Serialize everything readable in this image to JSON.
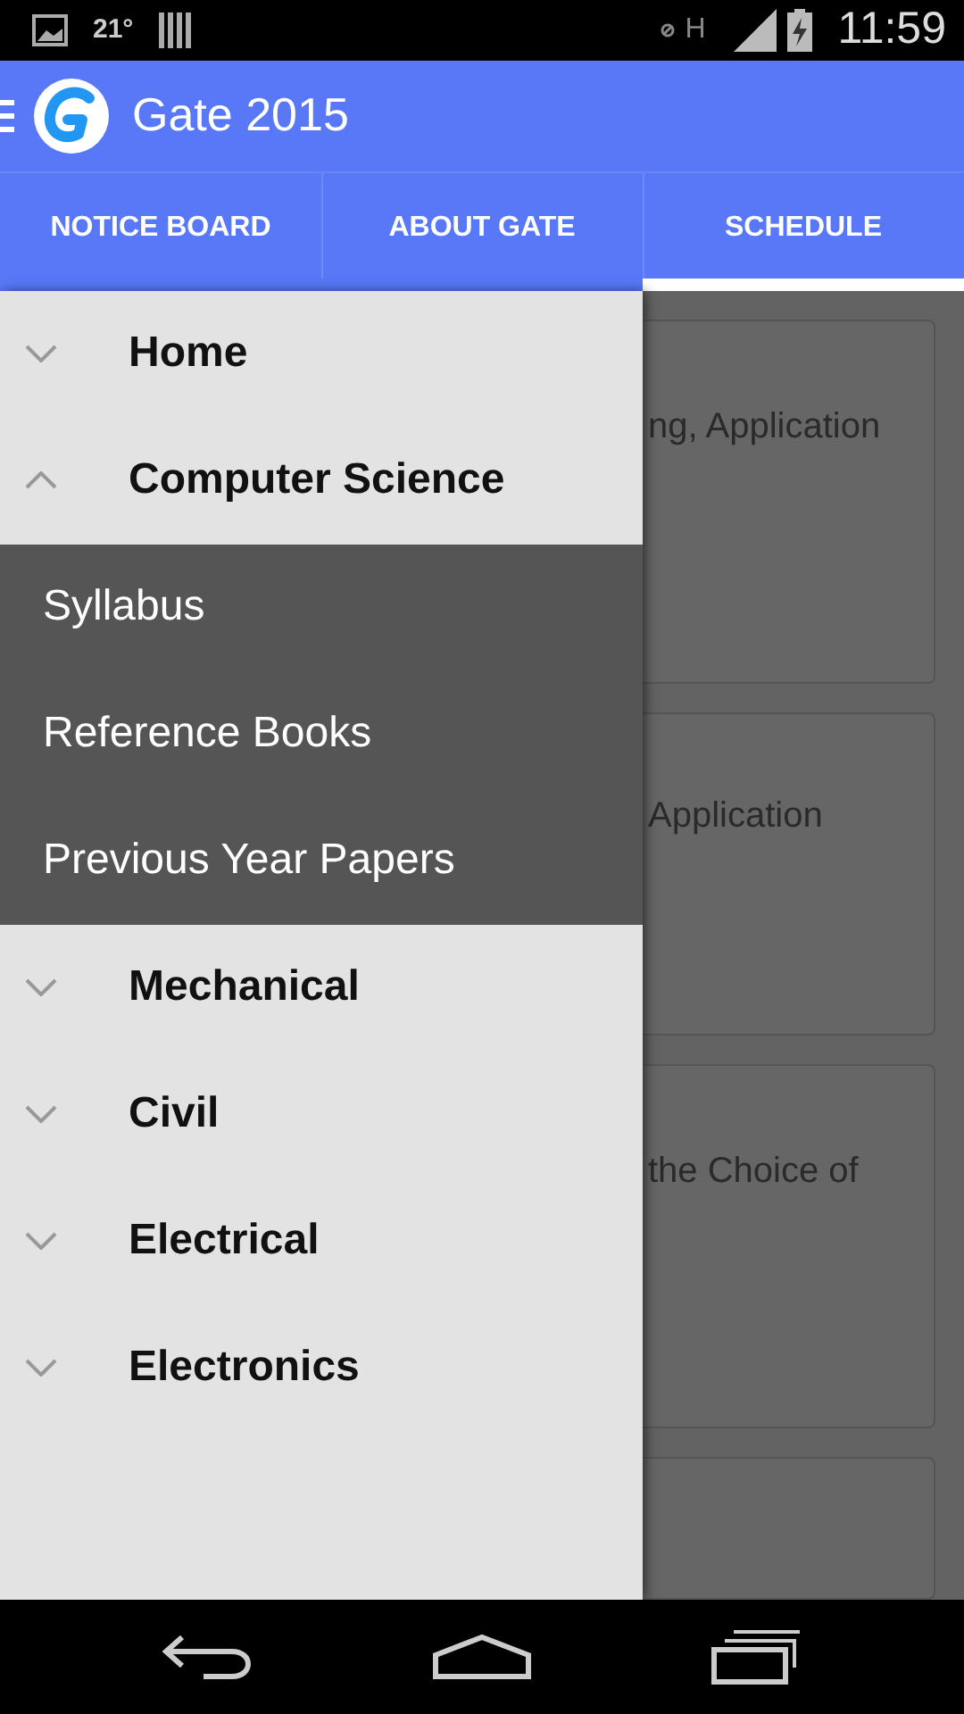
{
  "status_bar": {
    "temperature": "21°",
    "network": "H",
    "time": "11:59"
  },
  "app_bar": {
    "title": "Gate 2015"
  },
  "tabs": [
    {
      "label": "NOTICE BOARD",
      "selected": false
    },
    {
      "label": "ABOUT GATE",
      "selected": false
    },
    {
      "label": "SCHEDULE",
      "selected": true
    }
  ],
  "cards": [
    {
      "text": "ng, Application"
    },
    {
      "text": "Application"
    },
    {
      "text": "the Choice of"
    }
  ],
  "drawer": {
    "items": [
      {
        "label": "Home",
        "expanded": false
      },
      {
        "label": "Computer Science",
        "expanded": true,
        "children": [
          {
            "label": "Syllabus"
          },
          {
            "label": "Reference Books"
          },
          {
            "label": "Previous Year Papers"
          }
        ]
      },
      {
        "label": "Mechanical",
        "expanded": false
      },
      {
        "label": "Civil",
        "expanded": false
      },
      {
        "label": "Electrical",
        "expanded": false
      },
      {
        "label": "Electronics",
        "expanded": false
      }
    ]
  }
}
